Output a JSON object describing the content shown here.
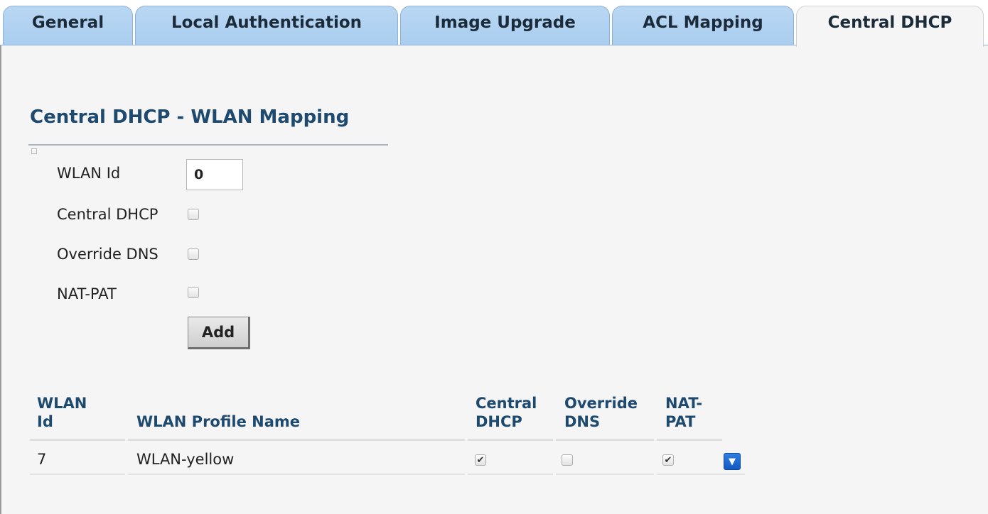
{
  "tabs": [
    {
      "label": "General",
      "active": false
    },
    {
      "label": "Local Authentication",
      "active": false
    },
    {
      "label": "Image Upgrade",
      "active": false
    },
    {
      "label": "ACL Mapping",
      "active": false
    },
    {
      "label": "Central DHCP",
      "active": true
    }
  ],
  "section": {
    "title": "Central DHCP - WLAN Mapping"
  },
  "form": {
    "wlan_id_label": "WLAN Id",
    "wlan_id_value": "0",
    "central_dhcp_label": "Central DHCP",
    "central_dhcp_checked": false,
    "override_dns_label": "Override DNS",
    "override_dns_checked": false,
    "nat_pat_label": "NAT-PAT",
    "nat_pat_checked": false,
    "add_label": "Add"
  },
  "table": {
    "headers": {
      "wlan_id": [
        "WLAN",
        "Id"
      ],
      "profile_name": "WLAN Profile Name",
      "central_dhcp": [
        "Central",
        "DHCP"
      ],
      "override_dns": [
        "Override",
        "DNS"
      ],
      "nat_pat": [
        "NAT-",
        "PAT"
      ]
    },
    "rows": [
      {
        "wlan_id": "7",
        "profile_name": "WLAN-yellow",
        "central_dhcp": true,
        "override_dns": false,
        "nat_pat": true,
        "action_icon": "dropdown-arrow-icon"
      }
    ]
  },
  "colors": {
    "tab_blue": "#b9d7f3",
    "heading_blue": "#1d4a6e",
    "panel_gray": "#f5f5f5",
    "action_blue": "#1f6fd6"
  }
}
